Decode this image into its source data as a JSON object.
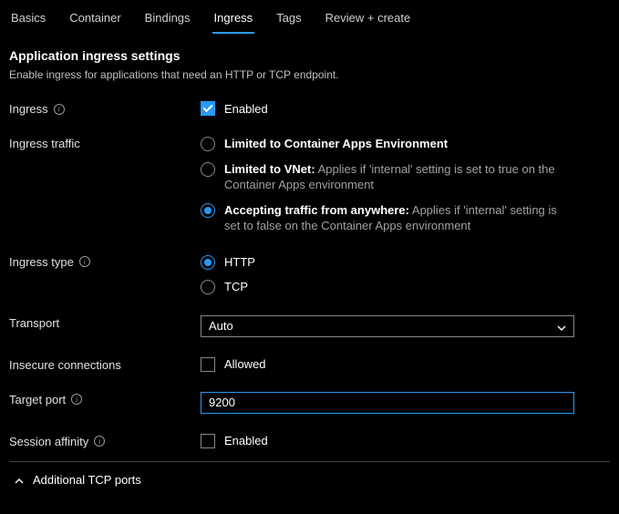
{
  "tabs": {
    "basics": "Basics",
    "container": "Container",
    "bindings": "Bindings",
    "ingress": "Ingress",
    "tags": "Tags",
    "review": "Review + create",
    "active": "ingress"
  },
  "section": {
    "title": "Application ingress settings",
    "desc": "Enable ingress for applications that need an HTTP or TCP endpoint."
  },
  "ingress": {
    "label": "Ingress",
    "enabled_label": "Enabled",
    "checked": true
  },
  "traffic": {
    "label": "Ingress traffic",
    "options": {
      "limited_env": {
        "title": "Limited to Container Apps Environment"
      },
      "limited_vnet": {
        "title": "Limited to VNet:",
        "desc": "Applies if 'internal' setting is set to true on the Container Apps environment"
      },
      "anywhere": {
        "title": "Accepting traffic from anywhere:",
        "desc": "Applies if 'internal' setting is set to false on the Container Apps environment"
      }
    },
    "selected": "anywhere"
  },
  "ingress_type": {
    "label": "Ingress type",
    "options": {
      "http": "HTTP",
      "tcp": "TCP"
    },
    "selected": "http"
  },
  "transport": {
    "label": "Transport",
    "value": "Auto"
  },
  "insecure": {
    "label": "Insecure connections",
    "value_label": "Allowed",
    "checked": false
  },
  "target_port": {
    "label": "Target port",
    "value": "9200"
  },
  "session_affinity": {
    "label": "Session affinity",
    "value_label": "Enabled",
    "checked": false
  },
  "expander": {
    "label": "Additional TCP ports"
  }
}
